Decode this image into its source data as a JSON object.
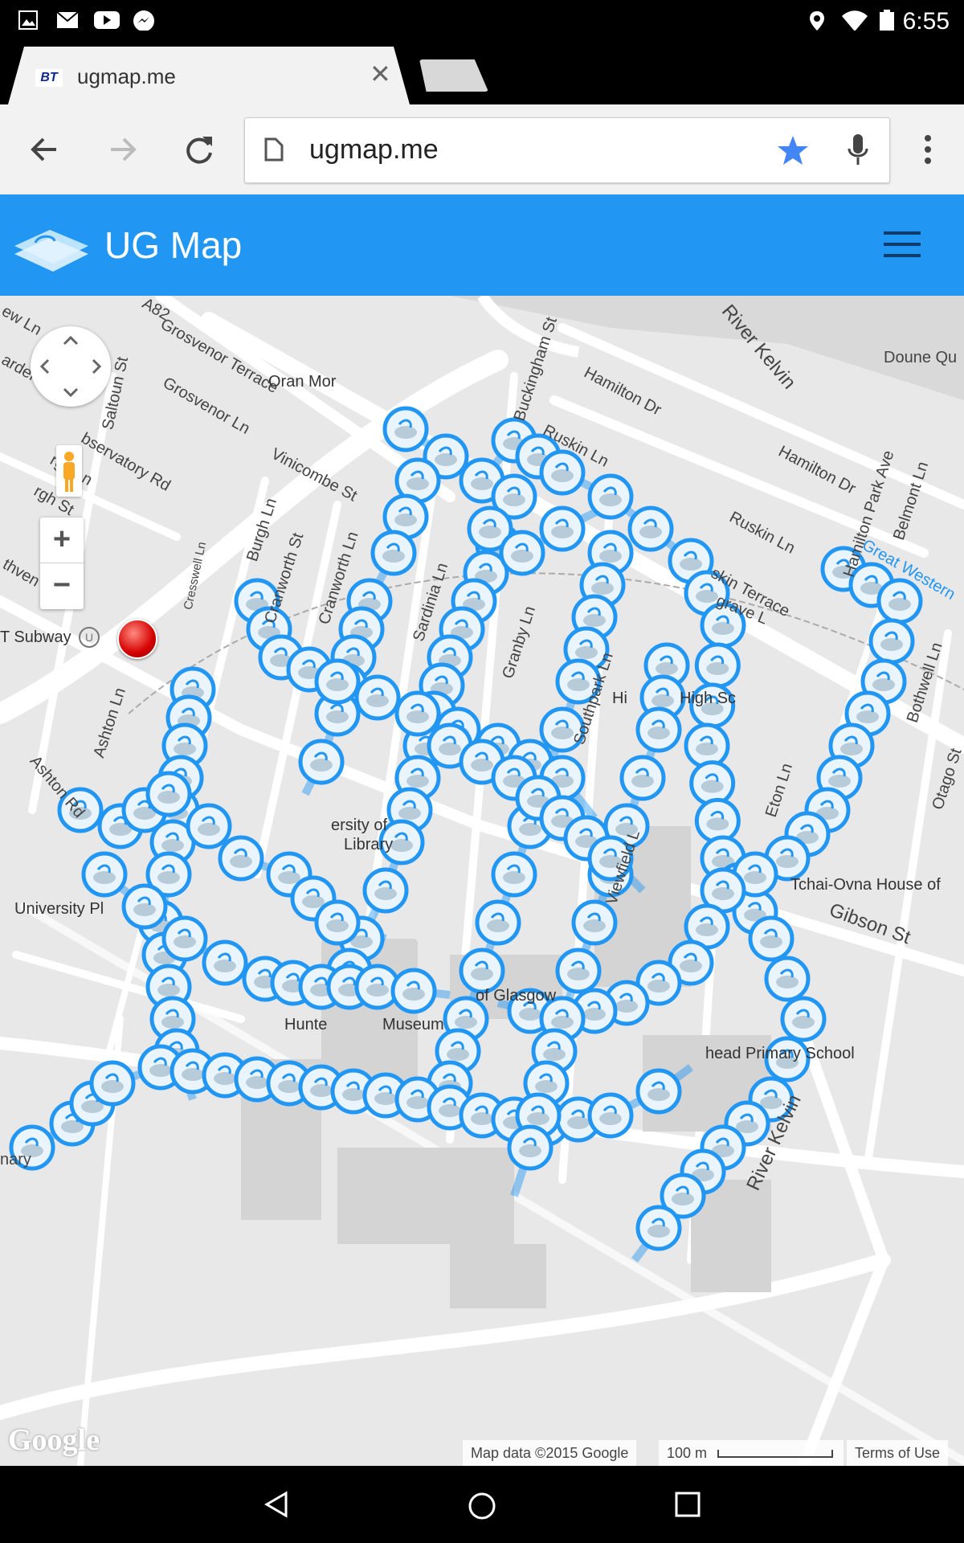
{
  "status_bar": {
    "time": "6:55",
    "icons": [
      "image-icon",
      "mail-icon",
      "youtube-icon",
      "messenger-icon",
      "location-icon",
      "wifi-icon",
      "battery-icon"
    ]
  },
  "browser": {
    "tab_title": "ugmap.me",
    "tab_favicon_text": "BT",
    "url": "ugmap.me"
  },
  "app": {
    "title": "UG Map",
    "brand_color": "#2196f3"
  },
  "map": {
    "labels": {
      "a82": "A82",
      "grosvenor_terrace": "Grosvenor Terrace",
      "grosvenor_ln": "Grosvenor Ln",
      "oran_mor": "Oran Mor",
      "saltoun": "Saltoun St",
      "observatory": "bservatory Rd",
      "vinicombe": "Vinicombe St",
      "burgh_ln": "Burgh Ln",
      "cranworth_st": "Cranworth St",
      "cranworth_ln": "Cranworth Ln",
      "cresswell": "Cresswell Ln",
      "sardinia": "Sardinia Ln",
      "granby": "Granby Ln",
      "southpark": "Southpark Ln",
      "buckingham": "Buckingham St",
      "hamilton_dr": "Hamilton Dr",
      "hamilton_dr2": "Hamilton Dr",
      "ruskin_ln": "Ruskin Ln",
      "ruskin_ln2": "Ruskin Ln",
      "ruskin_terrace": "skin Terrace",
      "hamilton_park": "Hamilton Park Ave",
      "belmont": "Belmont Ln",
      "river_kelvin_top": "River Kelvin",
      "doune": "Doune Qu",
      "hillhead_subway": "T Subway",
      "ashton_ln": "Ashton Ln",
      "ashton_rd": "Ashton Rd",
      "university_pl": "University Pl",
      "library1": "ersity of",
      "library2": "Library",
      "high_school": "High Sc",
      "hi": "Hi",
      "eton": "Eton Ln",
      "otago": "Otago St",
      "bothwell": "Bothwell Ln",
      "tchai": "Tchai-Ovna House of",
      "gibson": "Gibson St",
      "uni_glasgow": "of Glasgow",
      "hunterian": "Hunte",
      "museum": "Museum",
      "primary_school": "head Primary School",
      "river_kelvin_bottom": "River Kelvin",
      "nary": "nary",
      "viewfield": "Viewfield L",
      "grave": "grave L",
      "great_western": "Great Western",
      "athven": "thven St",
      "lew_ln": "ew Ln",
      "arden": "arden",
      "rgh_ln": "rgh Ln",
      "rgh_st": "rgh St"
    },
    "attribution": "Map data ©2015 Google",
    "scale": "100 m",
    "terms": "Terms of Use",
    "logo": "Google",
    "route_color": "#2196f3"
  }
}
